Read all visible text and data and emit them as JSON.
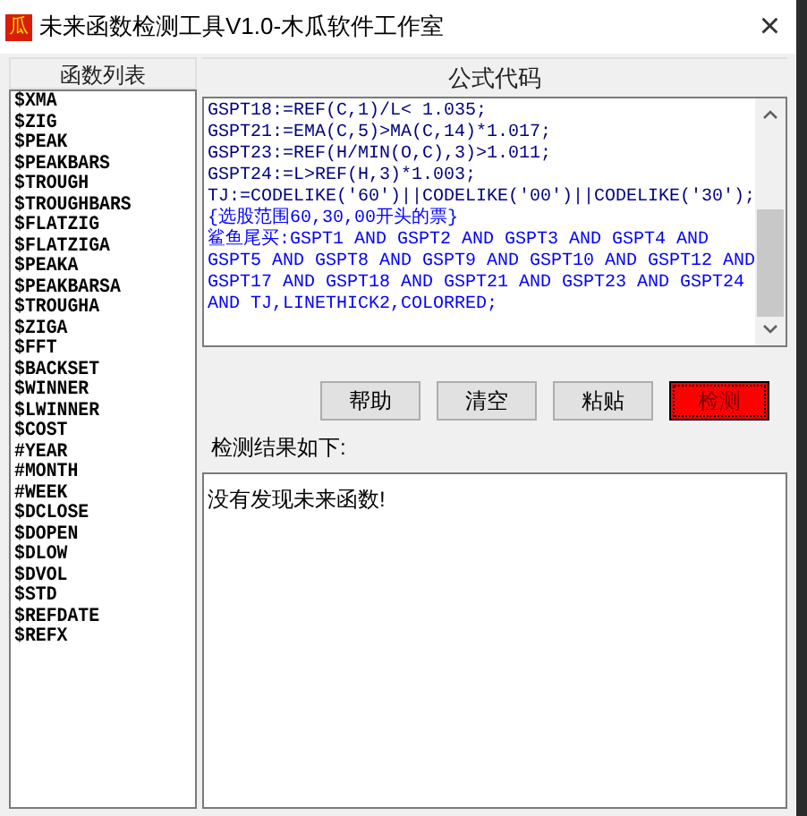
{
  "window": {
    "title": "未来函数检测工具V1.0-木瓜软件工作室",
    "app_icon": "瓜",
    "close": "×"
  },
  "function_list": {
    "header": "函数列表",
    "items": [
      "$XMA",
      "$ZIG",
      "$PEAK",
      "$PEAKBARS",
      "$TROUGH",
      "$TROUGHBARS",
      "$FLATZIG",
      "$FLATZIGA",
      "$PEAKA",
      "$PEAKBARSA",
      "$TROUGHA",
      "$ZIGA",
      "$FFT",
      "$BACKSET",
      "$WINNER",
      "$LWINNER",
      "$COST",
      "#YEAR",
      "#MONTH",
      "#WEEK",
      "$DCLOSE",
      "$DOPEN",
      "$DLOW",
      "$DVOL",
      "$STD",
      "$REFDATE",
      "$REFX"
    ]
  },
  "formula": {
    "header": "公式代码",
    "lines": [
      {
        "text": "GSPT18:=REF(C,1)/L< 1.035;",
        "color": "#000080"
      },
      {
        "text": "GSPT21:=EMA(C,5)>MA(C,14)*1.017;",
        "color": "#000080"
      },
      {
        "text": "GSPT23:=REF(H/MIN(O,C),3)>1.011;",
        "color": "#000080"
      },
      {
        "text": "GSPT24:=L>REF(H,3)*1.003;",
        "color": "#000080"
      },
      {
        "text": "TJ:=CODELIKE('60')||CODELIKE('00')||CODELIKE('30');",
        "color": "#000080"
      },
      {
        "text": "{选股范围60,30,00开头的票}",
        "color": "#0000ff"
      },
      {
        "text": "鲨鱼尾买:GSPT1 AND GSPT2 AND GSPT3 AND GSPT4 AND",
        "color": "#0000ff"
      },
      {
        "text": "GSPT5 AND GSPT8 AND GSPT9 AND GSPT10 AND GSPT12 AND",
        "color": "#0000ff"
      },
      {
        "text": "GSPT17 AND GSPT18 AND GSPT21 AND GSPT23 AND GSPT24",
        "color": "#0000ff"
      },
      {
        "text": "AND TJ,LINETHICK2,COLORRED;",
        "color": "#0000ff"
      }
    ]
  },
  "buttons": [
    {
      "label": "帮助",
      "primary": false
    },
    {
      "label": "清空",
      "primary": false
    },
    {
      "label": "粘贴",
      "primary": false
    },
    {
      "label": "检测",
      "primary": true
    }
  ],
  "result": {
    "label": "检测结果如下:",
    "text": "没有发现未来函数!"
  }
}
